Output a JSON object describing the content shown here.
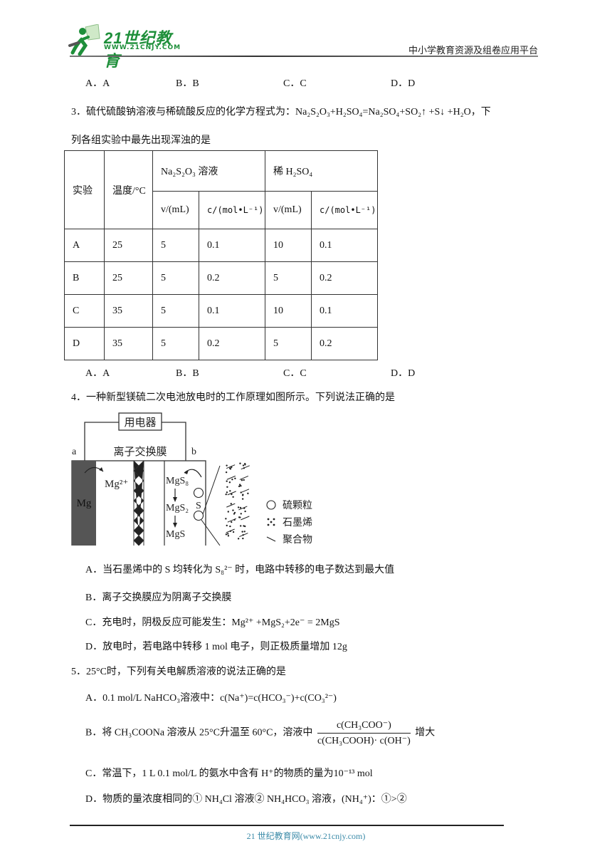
{
  "header": {
    "logo_title": "21世纪教育",
    "logo_url": "WWW.21CNJY.COM",
    "platform": "中小学教育资源及组卷应用平台"
  },
  "q2_options": [
    "A．A",
    "B．B",
    "C．C",
    "D．D"
  ],
  "q3": {
    "number": "3．",
    "stem_line1": "硫代硫酸钠溶液与稀硫酸反应的化学方程式为：",
    "equation": {
      "reactant1": [
        "Na",
        "2",
        "S",
        "2",
        "O",
        "3"
      ],
      "text": "Na₂S₂O₃+H₂SO₄=Na₂SO₄+SO₂↑ +S↓ +H₂O，下"
    },
    "stem_line2": "列各组实验中最先出现浑浊的是",
    "table": {
      "col_experiment": "实验",
      "col_temp": "温度/°C",
      "group1": "Na₂S₂O₃ 溶液",
      "group2": "稀 H₂SO₄",
      "sub_v": "v/(mL)",
      "sub_c": "c/(mol•L⁻¹)",
      "rows": [
        [
          "A",
          "25",
          "5",
          "0.1",
          "10",
          "0.1"
        ],
        [
          "B",
          "25",
          "5",
          "0.2",
          "5",
          "0.2"
        ],
        [
          "C",
          "35",
          "5",
          "0.1",
          "10",
          "0.1"
        ],
        [
          "D",
          "35",
          "5",
          "0.2",
          "5",
          "0.2"
        ]
      ]
    },
    "options": [
      "A．A",
      "B．B",
      "C．C",
      "D．D"
    ]
  },
  "q4": {
    "stem": "4．一种新型镁硫二次电池放电时的工作原理如图所示。下列说法正确的是",
    "diagram": {
      "load": "用电器",
      "membrane": "离子交换膜",
      "electrode_a": "a",
      "electrode_b": "b",
      "mg": "Mg",
      "mg_ion": "Mg²⁺",
      "mgs8": "MgS₈",
      "mgs2": "MgS₂",
      "mgs": "MgS",
      "s": "S",
      "legend": [
        "硫颗粒",
        "石墨烯",
        "聚合物"
      ]
    },
    "choices": {
      "A": "A．当石墨烯中的 S 均转化为 S₈²⁻ 时，电路中转移的电子数达到最大值",
      "B": "B．离子交换膜应为阴离子交换膜",
      "C": "C．充电时，阴极反应可能发生：Mg²⁺ +MgS₂+2e⁻ = 2MgS",
      "D": "D．放电时，若电路中转移 1 mol 电子，则正极质量增加 12g"
    }
  },
  "q5": {
    "stem": "5．25°C时，下列有关电解质溶液的说法正确的是",
    "choices": {
      "A": "A．0.1 mol/L  NaHCO₃溶液中：c(Na⁺)=c(HCO₃⁻)+c(CO₃²⁻)",
      "B_prefix": "B．将 CH₃COONa 溶液从 25°C升温至 60°C，溶液中",
      "B_num": "c(CH₃COO⁻)",
      "B_den": "c(CH₃COOH)· c(OH⁻)",
      "B_suffix": "增大",
      "C": "C．常温下，1 L 0.1 mol/L 的氨水中含有 H⁺的物质的量为10⁻¹³  mol",
      "D": "D．物质的量浓度相同的① NH₄Cl 溶液② NH₄HCO₃ 溶液，(NH₄⁺)：①>②"
    }
  },
  "footer": {
    "text": "21 世纪教育网(www.21cnjy.com)"
  }
}
